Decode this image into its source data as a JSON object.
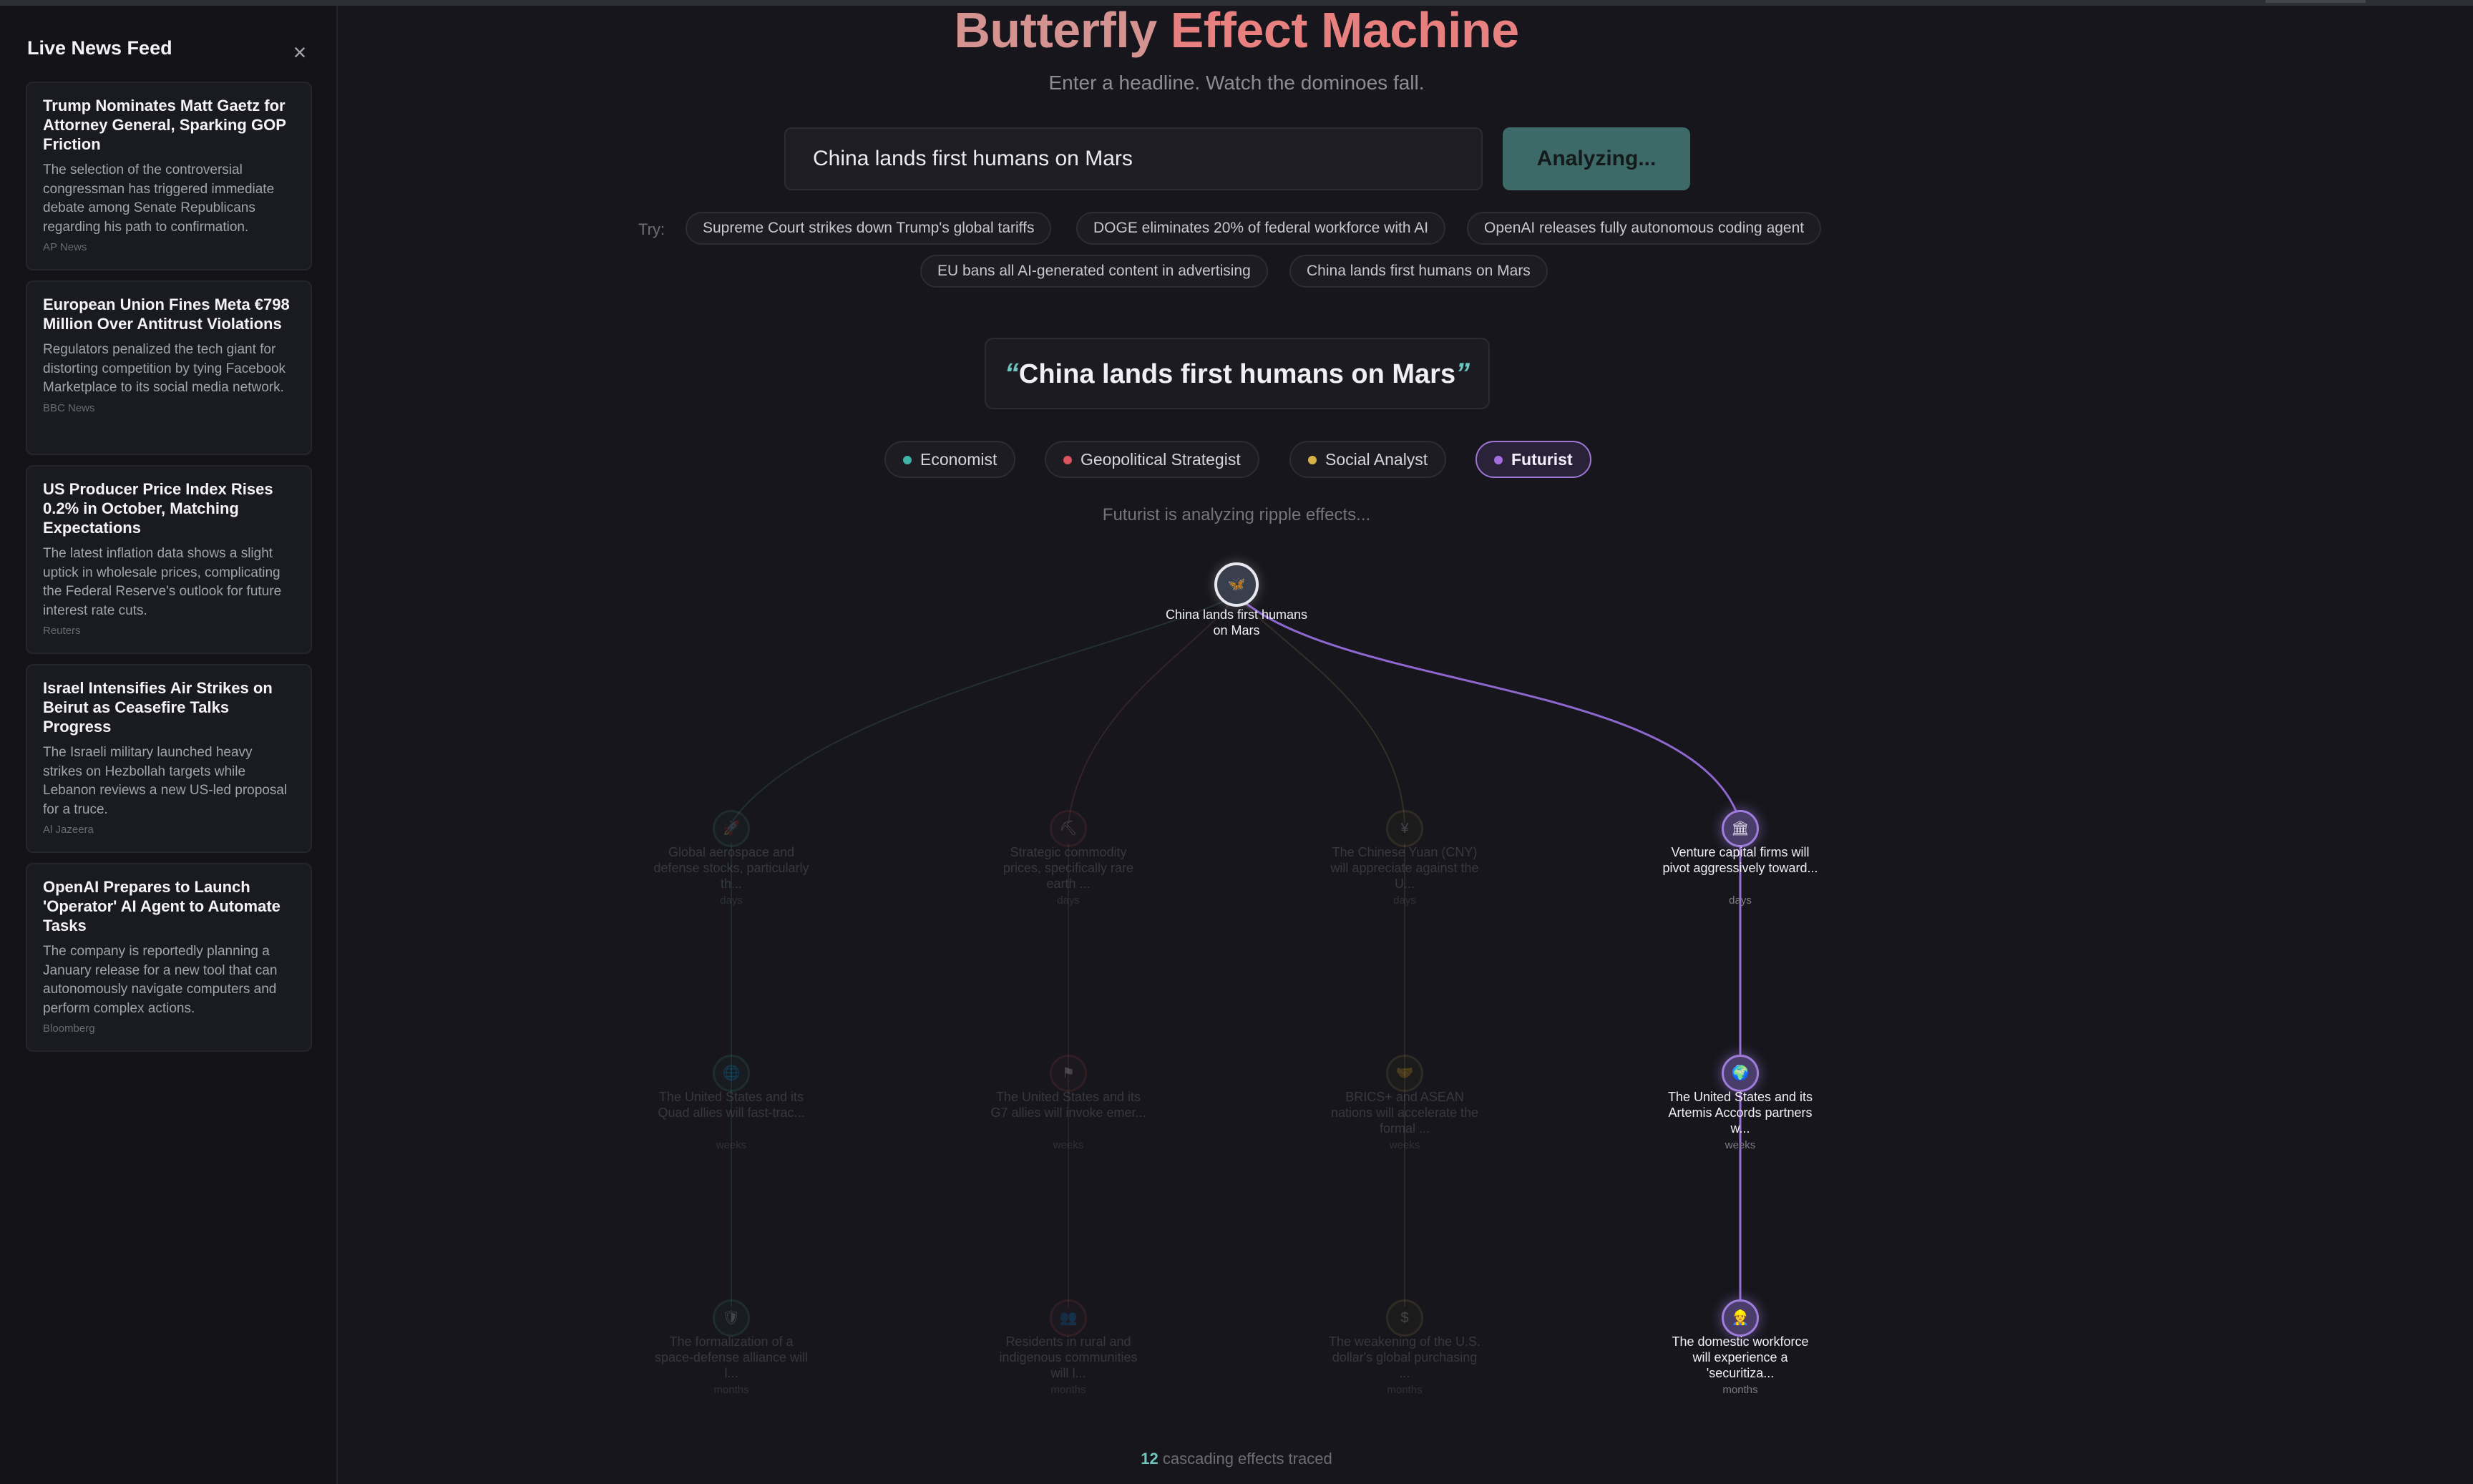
{
  "sidebar": {
    "title": "Live News Feed",
    "close_icon": "×",
    "news": [
      {
        "title": "Trump Nominates Matt Gaetz for Attorney General, Sparking GOP Friction",
        "desc": "The selection of the controversial congressman has triggered immediate debate among Senate Republicans regarding his path to confirmation.",
        "source": "AP News"
      },
      {
        "title": "European Union Fines Meta €798 Million Over Antitrust Violations",
        "desc": "Regulators penalized the tech giant for distorting competition by tying Facebook Marketplace to its social media network.",
        "source": "BBC News"
      },
      {
        "title": "US Producer Price Index Rises 0.2% in October, Matching Expectations",
        "desc": "The latest inflation data shows a slight uptick in wholesale prices, complicating the Federal Reserve's outlook for future interest rate cuts.",
        "source": "Reuters"
      },
      {
        "title": "Israel Intensifies Air Strikes on Beirut as Ceasefire Talks Progress",
        "desc": "The Israeli military launched heavy strikes on Hezbollah targets while Lebanon reviews a new US-led proposal for a truce.",
        "source": "Al Jazeera"
      },
      {
        "title": "OpenAI Prepares to Launch 'Operator' AI Agent to Automate Tasks",
        "desc": "The company is reportedly planning a January release for a new tool that can autonomously navigate computers and perform complex actions.",
        "source": "Bloomberg"
      }
    ]
  },
  "header": {
    "title_part1": "Butterfly ",
    "title_part2": "Effect Machine",
    "subtitle": "Enter a headline. Watch the dominoes fall."
  },
  "search": {
    "value": "China lands first humans on Mars",
    "button_label": "Analyzing..."
  },
  "suggestions": {
    "label": "Try:",
    "chips": [
      "Supreme Court strikes down Trump's global tariffs",
      "DOGE eliminates 20% of federal workforce with AI",
      "OpenAI releases fully autonomous coding agent",
      "EU bans all AI-generated content in advertising",
      "China lands first humans on Mars"
    ]
  },
  "headline": {
    "open_quote": "“",
    "text": "China lands first humans on Mars",
    "close_quote": "”"
  },
  "personas": [
    {
      "label": "Economist",
      "color": "#3fb3a6",
      "active": false
    },
    {
      "label": "Geopolitical Strategist",
      "color": "#d9545e",
      "active": false
    },
    {
      "label": "Social Analyst",
      "color": "#d6b24a",
      "active": false
    },
    {
      "label": "Futurist",
      "color": "#a46ee0",
      "active": true
    }
  ],
  "status": "Futurist is analyzing ripple effects...",
  "tree": {
    "root": {
      "label": "China lands first humans on Mars",
      "icon": "butterfly-icon",
      "glyph": "🦋"
    },
    "columns": [
      {
        "persona": "Economist",
        "nodes": [
          {
            "label": "Global aerospace and defense stocks, particularly th...",
            "time": "days",
            "icon": "rocket-icon",
            "glyph": "🚀"
          },
          {
            "label": "The United States and its Quad allies will fast-trac...",
            "time": "weeks",
            "icon": "globe-icon",
            "glyph": "🌐"
          },
          {
            "label": "The formalization of a space-defense alliance will l...",
            "time": "months",
            "icon": "shield-icon",
            "glyph": "🛡"
          }
        ]
      },
      {
        "persona": "Geopolitical Strategist",
        "nodes": [
          {
            "label": "Strategic commodity prices, specifically rare earth ...",
            "time": "days",
            "icon": "mineral-icon",
            "glyph": "⛏"
          },
          {
            "label": "The United States and its G7 allies will invoke emer...",
            "time": "weeks",
            "icon": "flag-icon",
            "glyph": "⚑"
          },
          {
            "label": "Residents in rural and indigenous communities will l...",
            "time": "months",
            "icon": "people-icon",
            "glyph": "👥"
          }
        ]
      },
      {
        "persona": "Social Analyst",
        "nodes": [
          {
            "label": "The Chinese Yuan (CNY) will appreciate against the U...",
            "time": "days",
            "icon": "currency-icon",
            "glyph": "¥"
          },
          {
            "label": "BRICS+ and ASEAN nations will accelerate the formal ...",
            "time": "weeks",
            "icon": "handshake-icon",
            "glyph": "🤝"
          },
          {
            "label": "The weakening of the U.S. dollar's global purchasing ...",
            "time": "months",
            "icon": "dollar-icon",
            "glyph": "$"
          }
        ]
      },
      {
        "persona": "Futurist",
        "nodes": [
          {
            "label": "Venture capital firms will pivot aggressively toward...",
            "time": "days",
            "icon": "building-icon",
            "glyph": "🏛"
          },
          {
            "label": "The United States and its Artemis Accords partners w...",
            "time": "weeks",
            "icon": "planet-icon",
            "glyph": "🌍"
          },
          {
            "label": "The domestic workforce will experience a 'securitiza...",
            "time": "months",
            "icon": "worker-icon",
            "glyph": "👷"
          }
        ]
      }
    ]
  },
  "footer": {
    "count": "12",
    "label": " cascading effects traced"
  }
}
